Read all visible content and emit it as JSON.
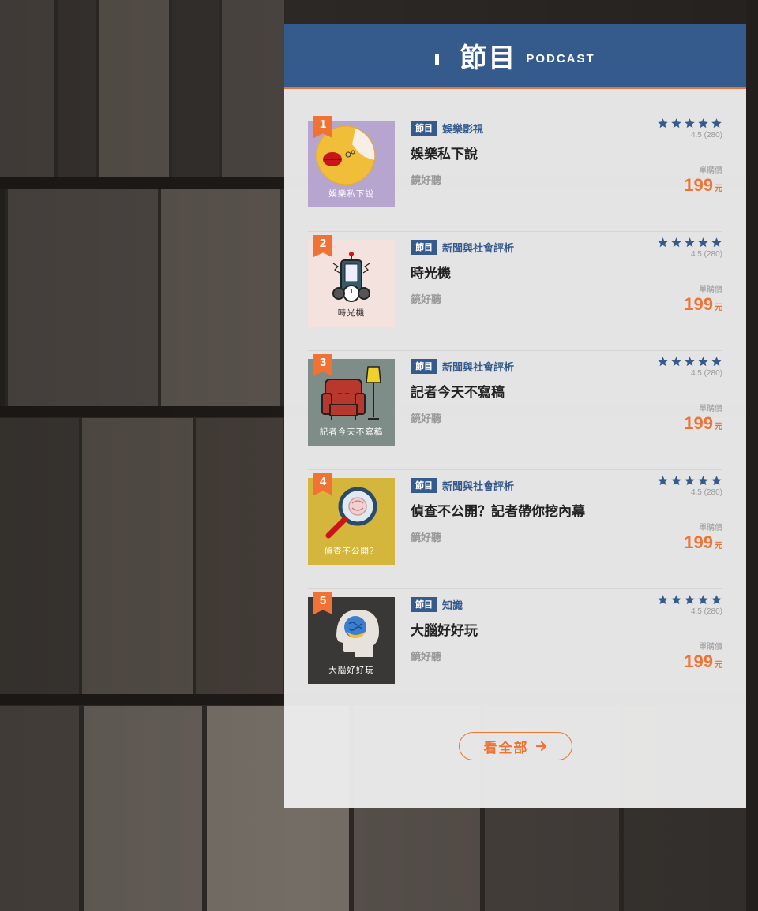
{
  "header": {
    "title": "節目",
    "subtitle": "PODCAST"
  },
  "colors": {
    "primary": "#355a8c",
    "accent": "#f07234"
  },
  "items": [
    {
      "rank": "1",
      "badge": "節目",
      "category": "娛樂影視",
      "title": "娛樂私下說",
      "publisher": "鏡好聽",
      "rating": "4.5 (280)",
      "stars": 5,
      "price_label": "單購價",
      "price": "199",
      "price_unit": "元",
      "cover_label": "娛樂私下說",
      "cover_bg": "#b6a6cf"
    },
    {
      "rank": "2",
      "badge": "節目",
      "category": "新聞與社會評析",
      "title": "時光機",
      "publisher": "鏡好聽",
      "rating": "4.5 (280)",
      "stars": 5,
      "price_label": "單購價",
      "price": "199",
      "price_unit": "元",
      "cover_label": "時光機",
      "cover_bg": "#f4e2df"
    },
    {
      "rank": "3",
      "badge": "節目",
      "category": "新聞與社會評析",
      "title": "記者今天不寫稿",
      "publisher": "鏡好聽",
      "rating": "4.5 (280)",
      "stars": 5,
      "price_label": "單購價",
      "price": "199",
      "price_unit": "元",
      "cover_label": "記者今天不寫稿",
      "cover_bg": "#7f8d88"
    },
    {
      "rank": "4",
      "badge": "節目",
      "category": "新聞與社會評析",
      "title": "偵查不公開？記者帶你挖內幕",
      "publisher": "鏡好聽",
      "rating": "4.5 (280)",
      "stars": 5,
      "price_label": "單購價",
      "price": "199",
      "price_unit": "元",
      "cover_label": "偵查不公開？",
      "cover_bg": "#d5b63c"
    },
    {
      "rank": "5",
      "badge": "節目",
      "category": "知識",
      "title": "大腦好好玩",
      "publisher": "鏡好聽",
      "rating": "4.5 (280)",
      "stars": 5,
      "price_label": "單購價",
      "price": "199",
      "price_unit": "元",
      "cover_label": "大腦好好玩",
      "cover_bg": "#3a3836"
    }
  ],
  "more_button": {
    "label": "看全部",
    "icon": "arrow-right-icon"
  }
}
